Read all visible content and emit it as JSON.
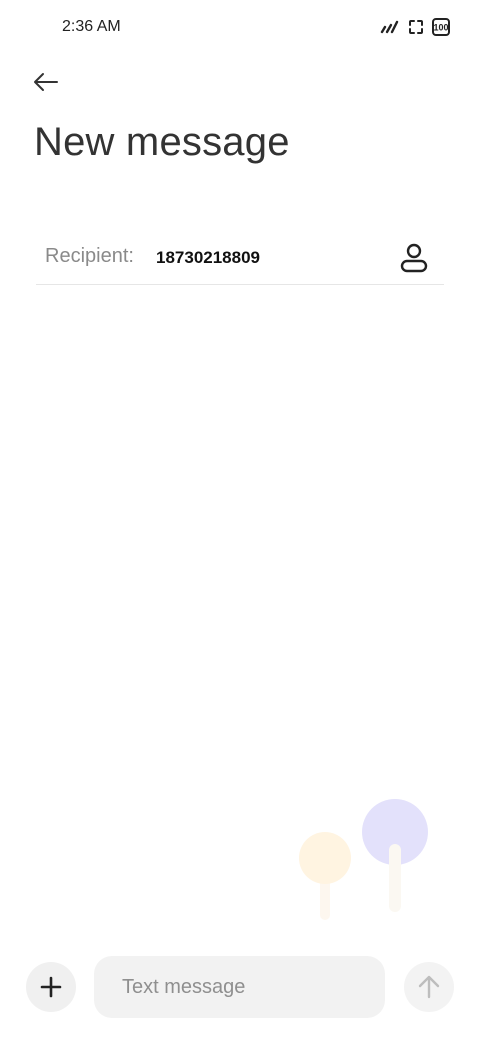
{
  "status_bar": {
    "time": "2:36 AM",
    "battery_level": "100",
    "icons": [
      "signal-icon",
      "screen-record-icon",
      "battery-icon"
    ]
  },
  "header": {
    "back_icon": "arrow-left-icon",
    "title": "New message"
  },
  "recipient": {
    "label": "Recipient:",
    "value": "18730218809",
    "contact_icon": "person-icon"
  },
  "composer": {
    "add_icon": "plus-icon",
    "placeholder": "Text message",
    "send_icon": "arrow-up-icon"
  },
  "colors": {
    "decor_yellow": "#fff6e6",
    "decor_purple": "#e3e1fb"
  }
}
